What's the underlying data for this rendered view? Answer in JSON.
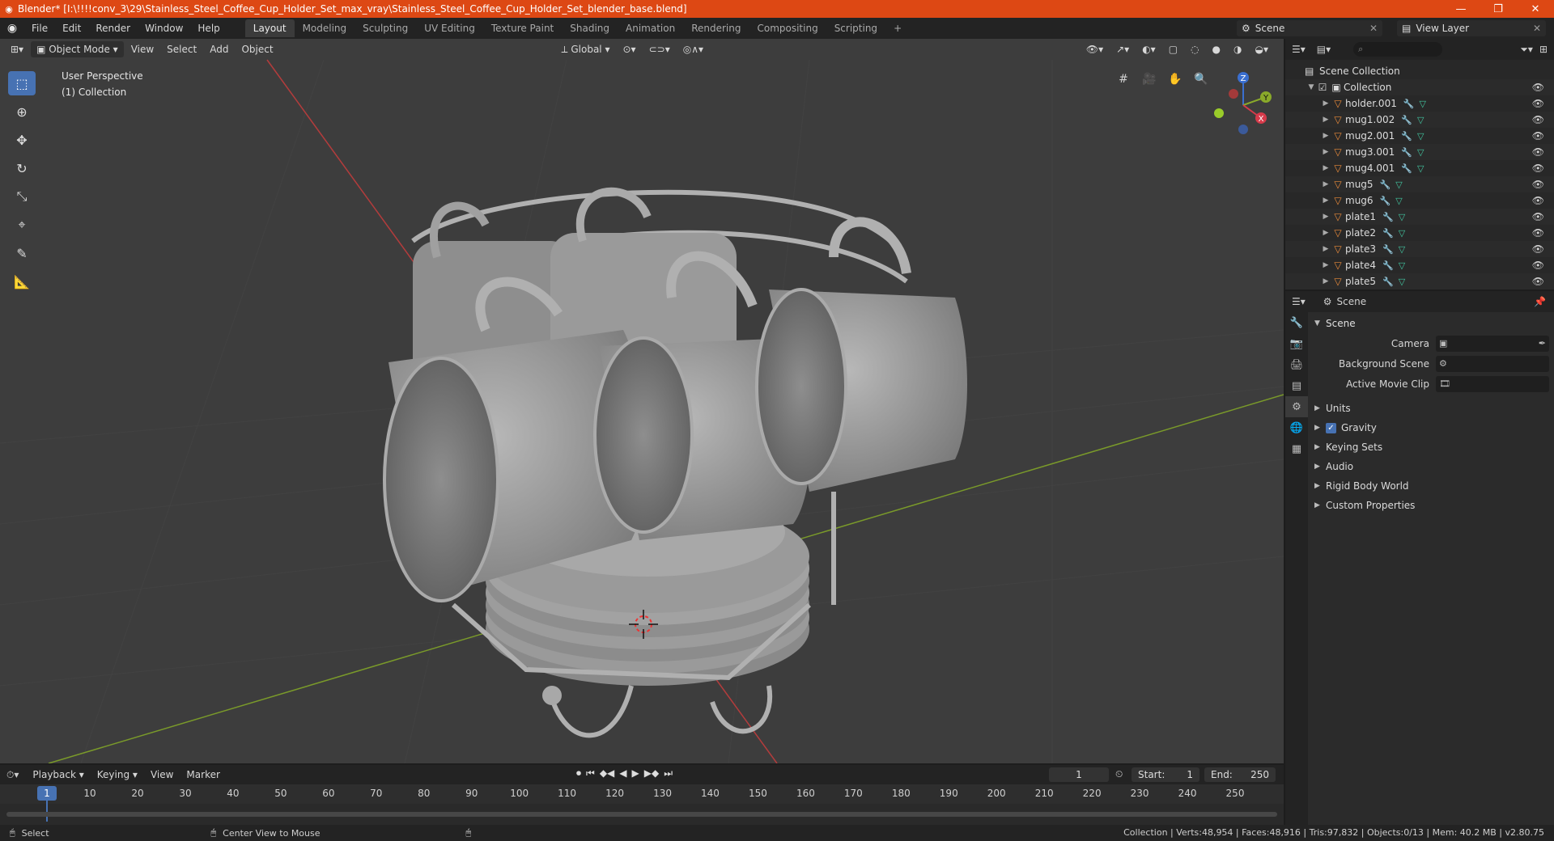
{
  "window": {
    "title": "Blender* [I:\\!!!!conv_3\\29\\Stainless_Steel_Coffee_Cup_Holder_Set_max_vray\\Stainless_Steel_Coffee_Cup_Holder_Set_blender_base.blend]"
  },
  "menu": [
    "File",
    "Edit",
    "Render",
    "Window",
    "Help"
  ],
  "workspaces": [
    "Layout",
    "Modeling",
    "Sculpting",
    "UV Editing",
    "Texture Paint",
    "Shading",
    "Animation",
    "Rendering",
    "Compositing",
    "Scripting"
  ],
  "workspace_add": "+",
  "scene_name": "Scene",
  "view_layer": "View Layer",
  "viewport": {
    "mode": "Object Mode",
    "menus": [
      "View",
      "Select",
      "Add",
      "Object"
    ],
    "transform": "Global",
    "info_line1": "User Perspective",
    "info_line2": "(1) Collection",
    "axis_x": "X",
    "axis_y": "Y",
    "axis_z": "Z"
  },
  "outliner": {
    "scene_collection": "Scene Collection",
    "collection": "Collection",
    "objects": [
      "holder.001",
      "mug1.002",
      "mug2.001",
      "mug3.001",
      "mug4.001",
      "mug5",
      "mug6",
      "plate1",
      "plate2",
      "plate3",
      "plate4",
      "plate5"
    ]
  },
  "properties": {
    "context": "Scene",
    "panel": "Scene",
    "camera_label": "Camera",
    "background_scene_label": "Background Scene",
    "active_clip_label": "Active Movie Clip",
    "subpanels": {
      "units": "Units",
      "gravity": "Gravity",
      "keying_sets": "Keying Sets",
      "audio": "Audio",
      "rigid_body": "Rigid Body World",
      "custom_props": "Custom Properties"
    }
  },
  "timeline": {
    "menus": [
      "Playback",
      "Keying",
      "View",
      "Marker"
    ],
    "current_frame": "1",
    "start_label": "Start:",
    "start": "1",
    "end_label": "End:",
    "end": "250",
    "ticks": [
      "1",
      "10",
      "20",
      "30",
      "40",
      "50",
      "60",
      "70",
      "80",
      "90",
      "100",
      "110",
      "120",
      "130",
      "140",
      "150",
      "160",
      "170",
      "180",
      "190",
      "200",
      "210",
      "220",
      "230",
      "240",
      "250"
    ]
  },
  "status": {
    "left": "Select",
    "middle": "Center View to Mouse",
    "right": "Collection | Verts:48,954 | Faces:48,916 | Tris:97,832 | Objects:0/13 | Mem: 40.2 MB | v2.80.75"
  },
  "colors": {
    "titlebar": "#dd4814",
    "accent": "#4772b3",
    "object_orange": "#e98a3a",
    "mesh_green": "#42c6a0"
  }
}
